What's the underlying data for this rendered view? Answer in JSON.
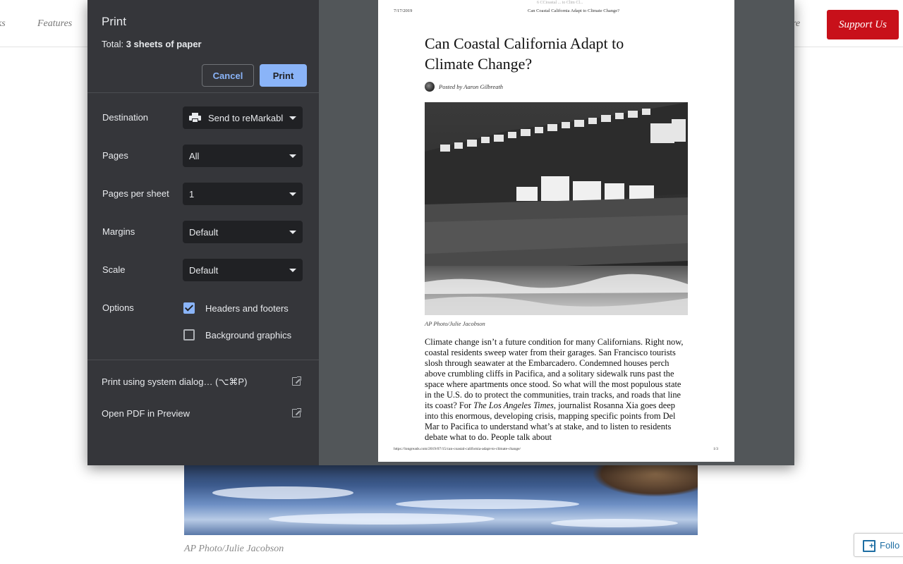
{
  "site": {
    "nav": [
      "ks",
      "Features",
      "re"
    ],
    "support_label": "Support Us",
    "photo_caption": "AP Photo/Julie Jacobson",
    "follow_label": "Follo"
  },
  "dialog": {
    "title": "Print",
    "total_prefix": "Total: ",
    "total_value": "3 sheets of paper",
    "cancel_label": "Cancel",
    "print_label": "Print",
    "settings": [
      {
        "label": "Destination",
        "value": "Send to reMarkabl",
        "icon": "printer-icon"
      },
      {
        "label": "Pages",
        "value": "All"
      },
      {
        "label": "Pages per sheet",
        "value": "1"
      },
      {
        "label": "Margins",
        "value": "Default"
      },
      {
        "label": "Scale",
        "value": "Default"
      }
    ],
    "options_label": "Options",
    "options": [
      {
        "label": "Headers and footers",
        "checked": true
      },
      {
        "label": "Background graphics",
        "checked": false
      }
    ],
    "system_dialog_label": "Print using system dialog… (⌥⌘P)",
    "open_pdf_label": "Open PDF in Preview",
    "accent_color": "#8ab4f8"
  },
  "preview": {
    "date": "7/17/2019",
    "header_title": "Can Coastal California Adapt to Climate Change?",
    "header_ghost": "6 CCioastal ... to Clim Cl...",
    "title": "Can Coastal California Adapt to Climate Change?",
    "author": "Posted by Aaron Gilbreath",
    "photo_caption": "AP Photo/Julie Jacobson",
    "body_before_italic": "Climate change isn’t a future condition for many Californians. Right now, coastal residents sweep water from their garages. San Francisco tourists slosh through seawater at the Embarcadero. Condemned houses perch above crumbling cliffs in Pacifica, and a solitary sidewalk runs past the space where apartments once stood. So what will the most populous state in the U.S. do to protect the communities, train tracks, and roads that line its coast? For ",
    "body_italic": "The Los Angeles Times",
    "body_after_italic": ", journalist Rosanna Xia goes deep into this enormous, developing crisis, mapping specific points from Del Mar to Pacifica to understand what’s at stake, and to listen to residents debate what to do. People talk about",
    "url": "https://longreads.com/2019/07/15/can-coastal-california-adapt-to-climate-change/",
    "page_num": "1/3"
  }
}
